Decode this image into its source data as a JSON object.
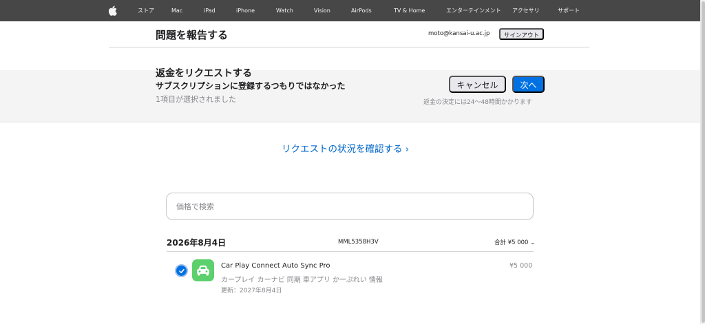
{
  "global_nav": {
    "items": [
      "ストア",
      "Mac",
      "iPad",
      "iPhone",
      "Watch",
      "Vision",
      "AirPods",
      "TV & Home",
      "エンターテインメント",
      "アクセサリ",
      "サポート"
    ]
  },
  "header": {
    "title": "問題を報告する",
    "email": "moto@kansai-u.ac.jp",
    "signout_label": "サインアウト"
  },
  "request": {
    "title": "返金をリクエストする",
    "reason": "サブスクリプションに登録するつもりではなかった",
    "selected_count": "1項目が選択されました",
    "cancel_label": "キャンセル",
    "next_label": "次へ",
    "refund_note": "返金の決定には24〜48時間かかります"
  },
  "status_link": {
    "label": "リクエストの状況を確認する ›"
  },
  "search": {
    "placeholder": "価格で検索"
  },
  "receipt": {
    "date": "2026年8月4日",
    "order_id": "MML5358H3V",
    "total_label": "合計 ¥5 000 ⌄",
    "items": [
      {
        "name": "Car Play Connect Auto Sync Pro",
        "keywords": "カープレイ カーナビ 同期 車アプリ かーぷれい 情報",
        "updated": "更新：2027年8月4日",
        "price": "¥5 000",
        "selected": true
      }
    ]
  },
  "colors": {
    "nav_bg": "#474747",
    "accent": "#0071e3",
    "link": "#0066cc",
    "app_icon": "#5bd06d"
  }
}
